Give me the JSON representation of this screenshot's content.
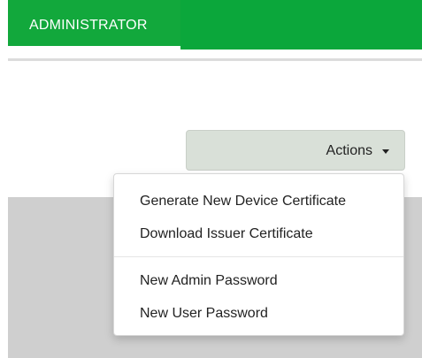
{
  "header": {
    "tab_label": "ADMINISTRATOR"
  },
  "actions": {
    "button_label": "Actions",
    "menu_items": [
      "Generate New Device Certificate",
      "Download Issuer Certificate",
      "New Admin Password",
      "New User Password"
    ]
  },
  "colors": {
    "header_green": "#0ba73b",
    "button_bg": "#d9e0d8",
    "panel_gray": "#cfcfcf"
  },
  "icons": {
    "actions_caret": "caret-down-icon"
  }
}
